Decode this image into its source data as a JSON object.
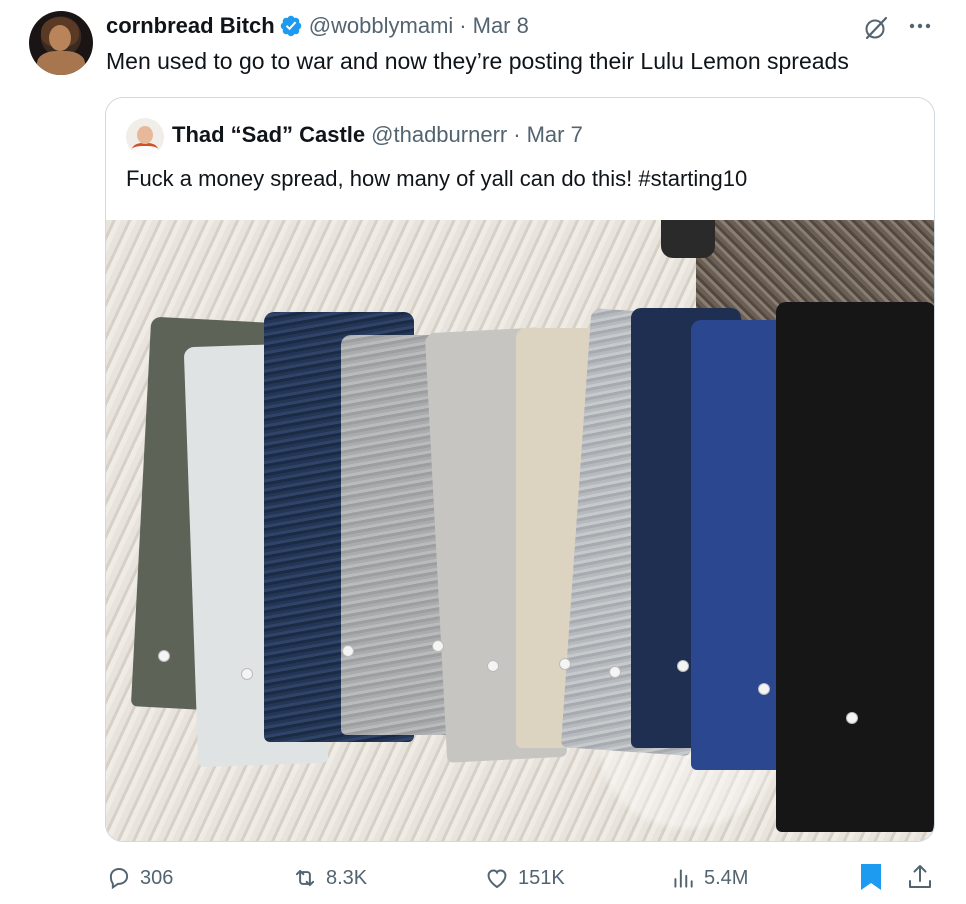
{
  "author": {
    "name": "cornbread Bitch",
    "handle": "@wobblymami",
    "separator": "·",
    "date": "Mar 8",
    "verified": true
  },
  "tweet_text": "Men used to go to war and now they’re posting their Lulu Lemon spreads",
  "quoted": {
    "name": "Thad “Sad” Castle",
    "handle": "@thadburnerr",
    "separator": "·",
    "date": "Mar 7",
    "text": "Fuck a money spread, how many of yall can do this! #starting10"
  },
  "metrics": {
    "replies": "306",
    "reposts": "8.3K",
    "likes": "151K",
    "views": "5.4M"
  },
  "icons": {
    "verified": "verified-badge-icon",
    "grok": "grok-icon",
    "more": "more-icon",
    "reply": "reply-icon",
    "repost": "repost-icon",
    "like": "like-icon",
    "views": "views-icon",
    "bookmark": "bookmark-icon",
    "share": "share-icon"
  },
  "colors": {
    "accent": "#1d9bf0",
    "secondary_text": "#536471",
    "primary_text": "#0f1419",
    "border": "#cfd9de"
  }
}
